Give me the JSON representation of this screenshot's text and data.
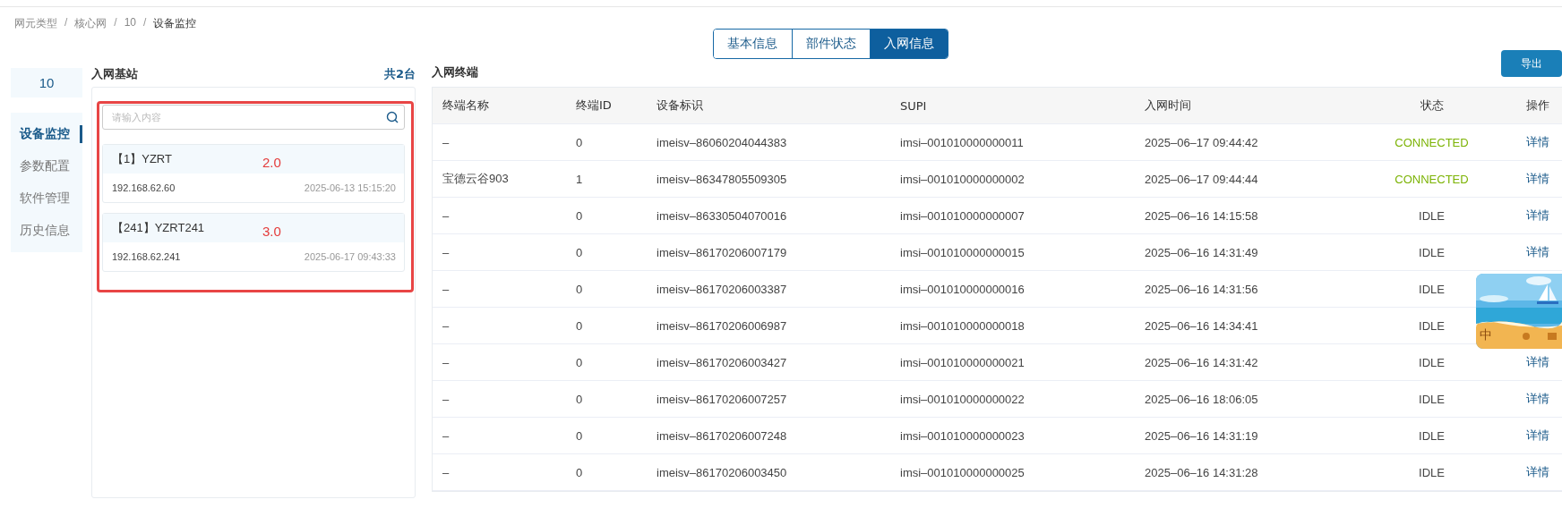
{
  "breadcrumb": [
    {
      "label": "网元类型"
    },
    {
      "separator": "/",
      "label": "核心网"
    },
    {
      "separator": "/",
      "label": "10"
    },
    {
      "separator": "/",
      "label": "设备监控"
    }
  ],
  "tabs": [
    {
      "label": "基本信息",
      "selected": false
    },
    {
      "label": "部件状态",
      "selected": false
    },
    {
      "label": "入网信息",
      "selected": true
    }
  ],
  "device": {
    "name": "10"
  },
  "nav": [
    {
      "label": "设备监控",
      "selected": true
    },
    {
      "label": "参数配置",
      "selected": false
    },
    {
      "label": "软件管理",
      "selected": false
    },
    {
      "label": "历史信息",
      "selected": false
    }
  ],
  "stations": {
    "title": "入网基站",
    "count": "共2台",
    "search": {
      "placeholder": "请输入内容"
    },
    "items": [
      {
        "title": "【1】YZRT",
        "ip": "192.168.62.60",
        "time": "2025-06-13 15:15:20",
        "note": "2.0"
      },
      {
        "title": "【241】YZRT241",
        "ip": "192.168.62.241",
        "time": "2025-06-17 09:43:33",
        "note": "3.0"
      }
    ]
  },
  "terminals": {
    "title": "入网终端",
    "export": "导出",
    "columns": [
      "终端名称",
      "终端ID",
      "设备标识",
      "SUPI",
      "入网时间",
      "状态",
      "操作"
    ],
    "rows": [
      {
        "name": "–",
        "id": "0",
        "imei": "imeisv–86060204044383",
        "supi": "imsi–001010000000011",
        "time": "2025–06–17 09:44:42",
        "status": "CONNECTED",
        "online": true,
        "action": "详情"
      },
      {
        "name": "宝德云谷903",
        "id": "1",
        "imei": "imeisv–86347805509305",
        "supi": "imsi–001010000000002",
        "time": "2025–06–17 09:44:44",
        "status": "CONNECTED",
        "online": true,
        "action": "详情"
      },
      {
        "name": "–",
        "id": "0",
        "imei": "imeisv–86330504070016",
        "supi": "imsi–001010000000007",
        "time": "2025–06–16 14:15:58",
        "status": "IDLE",
        "online": false,
        "action": "详情"
      },
      {
        "name": "–",
        "id": "0",
        "imei": "imeisv–86170206007179",
        "supi": "imsi–001010000000015",
        "time": "2025–06–16 14:31:49",
        "status": "IDLE",
        "online": false,
        "action": "详情"
      },
      {
        "name": "–",
        "id": "0",
        "imei": "imeisv–86170206003387",
        "supi": "imsi–001010000000016",
        "time": "2025–06–16 14:31:56",
        "status": "IDLE",
        "online": false
      },
      {
        "name": "–",
        "id": "0",
        "imei": "imeisv–86170206006987",
        "supi": "imsi–001010000000018",
        "time": "2025–06–16 14:34:41",
        "status": "IDLE",
        "online": false
      },
      {
        "name": "–",
        "id": "0",
        "imei": "imeisv–86170206003427",
        "supi": "imsi–001010000000021",
        "time": "2025–06–16 14:31:42",
        "status": "IDLE",
        "online": false,
        "action": "详情"
      },
      {
        "name": "–",
        "id": "0",
        "imei": "imeisv–86170206007257",
        "supi": "imsi–001010000000022",
        "time": "2025–06–16 18:06:05",
        "status": "IDLE",
        "online": false,
        "action": "详情"
      },
      {
        "name": "–",
        "id": "0",
        "imei": "imeisv–86170206007248",
        "supi": "imsi–001010000000023",
        "time": "2025–06–16 14:31:19",
        "status": "IDLE",
        "online": false,
        "action": "详情"
      },
      {
        "name": "–",
        "id": "0",
        "imei": "imeisv–86170206003450",
        "supi": "imsi–001010000000025",
        "time": "2025–06–16 14:31:28",
        "status": "IDLE",
        "online": false,
        "action": "详情"
      }
    ]
  },
  "ime_widget": {
    "mode": "中"
  }
}
